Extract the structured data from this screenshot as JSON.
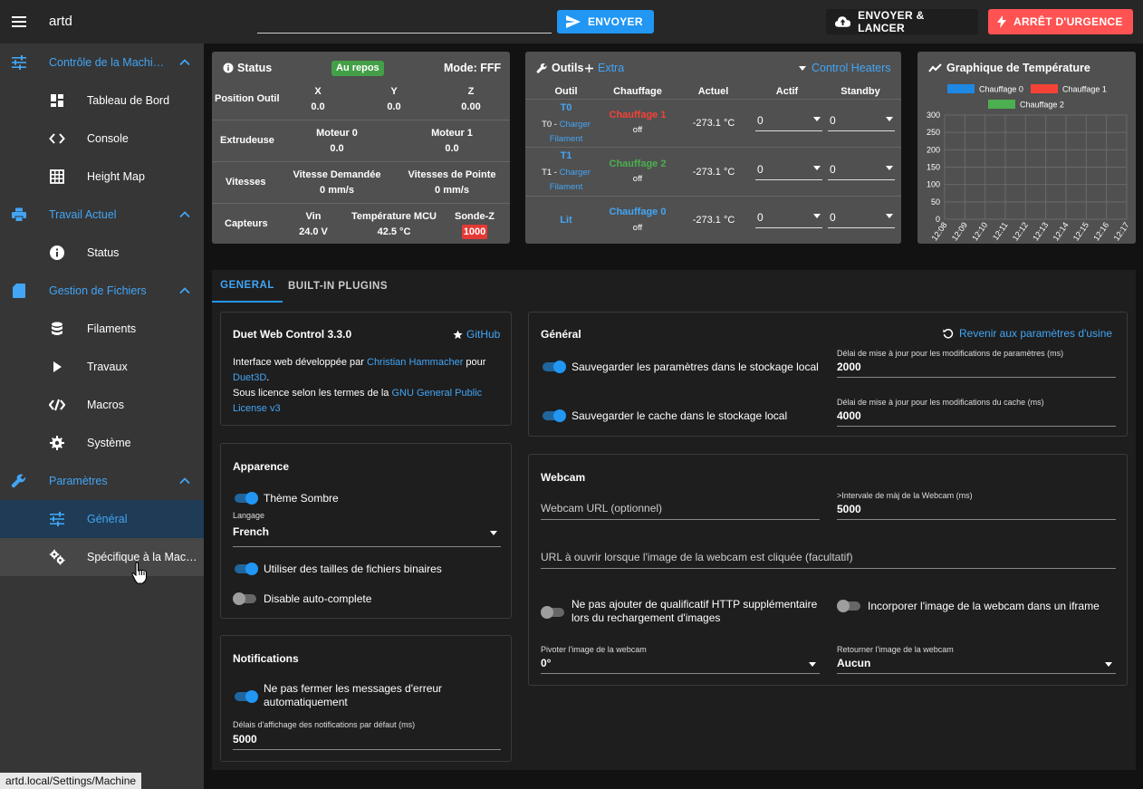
{
  "topbar": {
    "title": "artd",
    "gcode_value": "",
    "send_label": "ENVOYER",
    "upload_label": "ENVOYER & LANCER",
    "estop_label": "ARRÊT D'URGENCE"
  },
  "sidebar": {
    "machine_control": "Contrôle de la Machi…",
    "dashboard": "Tableau de Bord",
    "console": "Console",
    "height_map": "Height Map",
    "current_job": "Travail Actuel",
    "status": "Status",
    "file_management": "Gestion de Fichiers",
    "filaments": "Filaments",
    "jobs": "Travaux",
    "macros": "Macros",
    "system": "Système",
    "settings": "Paramètres",
    "general": "Général",
    "machine_specific": "Spécifique à la Mac…"
  },
  "status_bar": "artd.local/Settings/Machine",
  "status_card": {
    "title": "Status",
    "badge": "Au repos",
    "mode": "Mode: FFF",
    "tool_position": "Position Outil",
    "x_label": "X",
    "x_value": "0.0",
    "y_label": "Y",
    "y_value": "0.0",
    "z_label": "Z",
    "z_value": "0.00",
    "extruders": "Extrudeuse",
    "drive0_label": "Moteur 0",
    "drive0_value": "0.0",
    "drive1_label": "Moteur 1",
    "drive1_value": "0.0",
    "speeds": "Vitesses",
    "requested_label": "Vitesse Demandée",
    "requested_value": "0 mm/s",
    "top_label": "Vitesses de Pointe",
    "top_value": "0 mm/s",
    "sensors": "Capteurs",
    "vin_label": "Vin",
    "vin_value": "24.0 V",
    "mcu_label": "Température MCU",
    "mcu_value": "42.5 °C",
    "zprobe_label": "Sonde-Z",
    "zprobe_value": "1000"
  },
  "tools_card": {
    "title": "Outils",
    "extra": "Extra",
    "control_heaters": "Control Heaters",
    "headers": [
      "Outil",
      "Chauffage",
      "Actuel",
      "Actif",
      "Standby"
    ],
    "rows": [
      {
        "tool": "T0",
        "sub": "T0 - ",
        "link": "Charger",
        "link2": "Filament",
        "heater": "Chauffage 1",
        "heater_color": "#f44336",
        "state": "off",
        "current": "-273.1 °C",
        "active": "0",
        "standby": "0"
      },
      {
        "tool": "T1",
        "sub": "T1 - ",
        "link": "Charger",
        "link2": "Filament",
        "heater": "Chauffage 2",
        "heater_color": "#4caf50",
        "state": "off",
        "current": "-273.1 °C",
        "active": "0",
        "standby": "0"
      },
      {
        "tool": "Lit",
        "sub": "",
        "link": "",
        "link2": "",
        "heater": "Chauffage 0",
        "heater_color": "#42a5f5",
        "state": "off",
        "current": "-273.1 °C",
        "active": "0",
        "standby": "0"
      }
    ]
  },
  "chart_data": {
    "type": "line",
    "title": "Graphique de Température",
    "series": [
      {
        "name": "Chauffage 0",
        "color": "#1e88e5",
        "values": []
      },
      {
        "name": "Chauffage 1",
        "color": "#f44336",
        "values": []
      },
      {
        "name": "Chauffage 2",
        "color": "#4caf50",
        "values": []
      }
    ],
    "x": [
      "12:08",
      "12:09",
      "12:10",
      "12:11",
      "12:12",
      "12:13",
      "12:14",
      "12:15",
      "12:16",
      "12:17"
    ],
    "yticks": [
      300,
      250,
      200,
      150,
      100,
      50,
      0
    ],
    "ylim": [
      0,
      300
    ],
    "grid": true,
    "legend": "top"
  },
  "settings": {
    "tab_general": "GENERAL",
    "tab_plugins": "BUILT-IN PLUGINS",
    "about": {
      "title": "Duet Web Control 3.3.0",
      "github": "GitHub",
      "line1_prefix": "Interface web développée par ",
      "author": "Christian Hammacher",
      "line1_suffix": " pour",
      "company": "Duet3D",
      "period": ".",
      "line2_prefix": "Sous licence selon les termes de la ",
      "license_a": "GNU General Public",
      "license_b": "License v3"
    },
    "appearance": {
      "title": "Apparence",
      "dark_theme": "Thème Sombre",
      "language_label": "Langage",
      "language_value": "French",
      "binary_sizes": "Utiliser des tailles de fichiers binaires",
      "autocomplete": "Disable auto-complete"
    },
    "notifications": {
      "title": "Notifications",
      "persistent_a": "Ne pas fermer les messages d'erreur",
      "persistent_b": "automatiquement",
      "timeout_label": "Délais d'affichage des notifications par défaut (ms)",
      "timeout_value": "5000"
    },
    "general": {
      "title": "Général",
      "reset": "Revenir aux paramètres d'usine",
      "save_local": "Sauvegarder les paramètres dans le stockage local",
      "settings_delay_label": "Délai de mise à jour pour les modifications de paramètres (ms)",
      "settings_delay_value": "2000",
      "cache_local": "Sauvegarder le cache dans le stockage local",
      "cache_delay_label": "Délai de mise à jour pour les modifications du cache (ms)",
      "cache_delay_value": "4000"
    },
    "webcam": {
      "title": "Webcam",
      "url_placeholder": "Webcam URL (optionnel)",
      "interval_label": ">Intervale de màj de la Webcam (ms)",
      "interval_value": "5000",
      "click_placeholder": "URL à ouvrir lorsque l'image de la webcam est cliquée (facultatif)",
      "no_qualifier_a": "Ne pas ajouter de qualificatif HTTP supplémentaire",
      "no_qualifier_b": "lors du rechargement d'images",
      "iframe": "Incorporer l'image de la webcam dans un iframe",
      "rotate_label": "Pivoter l'image de la webcam",
      "rotate_value": "0°",
      "flip_label": "Retourner l'image de la webcam",
      "flip_value": "Aucun"
    }
  }
}
